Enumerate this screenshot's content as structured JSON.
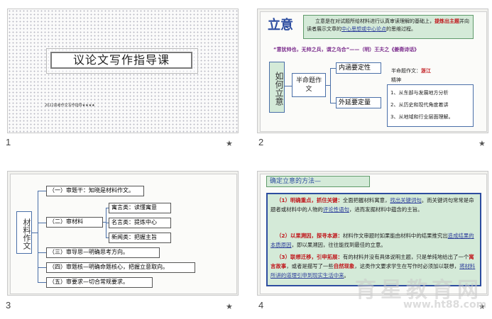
{
  "slides": [
    {
      "number": "1",
      "title": "议论文写作指导课",
      "subtitle": "2022高考作文写作指导★★★★"
    },
    {
      "number": "2",
      "heading": "立意",
      "intro_a": "立意是在对试题所给材料进行认真审读理解的基础上，",
      "intro_red": "提炼出主题",
      "intro_b": "并向读者展示文章的",
      "intro_link": "中心思想或中心论点",
      "intro_c": "的思维过程。",
      "quote": "“意犹帅也，无帅之兵，谓之乌合”——（明）王夫之《姜斋诗话》",
      "side_label": "如何立意",
      "type_box": "半命题作文",
      "top_box": "内涵要定性",
      "bottom_box": "外延要定量",
      "example_label": "半命题作文：",
      "example_red": "浙江",
      "example_line2": "精神",
      "list": [
        "1、从东部与发展地方分析",
        "2、从历史和现代角度着讲",
        "3、从地域和行业层面理解。"
      ]
    },
    {
      "number": "3",
      "side_label": "材料作文",
      "item1": "（一）审题干：知晓是材料作文。",
      "item2": "（二）审材料",
      "sub1": "寓言类：读懂寓意",
      "sub2": "名言类：提炼中心",
      "sub3": "新闻类：把握主旨",
      "item3": "（三）审导思—明确思考方向。",
      "item4": "（四）审题核—明确命题核心，把握立意取向。",
      "item5": "（五）审要求—切合常规要求。"
    },
    {
      "number": "4",
      "heading": "确定立意的方法—",
      "p1_red": "（1）明确重点，抓住关键：",
      "p1_a": "全面把握材料寓意，",
      "p1_link1": "找出关键词句",
      "p1_b": "。而关键词句常常是命题者或材料中的人物的",
      "p1_link2": "评论性语句",
      "p1_c": "，进而发掘材料中蕴含的主旨。",
      "p2_red": "（2）以果溯因，探寻本源：",
      "p2_a": "材料作文审题时如果能由材料中的结果推究出",
      "p2_link": "造成结果的本质原因",
      "p2_b": "，即以果溯因，往往能找到最佳的立意。",
      "p3_red": "（3）联想迁移，引申拓展：",
      "p3_a": "有的材料并没有具体说明主题，只是单纯地给出了一个",
      "p3_red2": "寓言故事",
      "p3_b": "，或者是描写了一些",
      "p3_red3": "自然现象",
      "p3_c": "，这类作文要求学生在写作时必须加以联想，",
      "p3_link": "将材料所讲的道理引申到现实生活中来",
      "p3_d": "。"
    }
  ],
  "watermark": {
    "brand": "育星教育网",
    "url": "www.ht88.com"
  },
  "icons": {
    "transition": "star-icon"
  },
  "colors": {
    "accent_blue": "#2d4da0",
    "heading_fill": "#d4ead8",
    "red": "#c0161b"
  }
}
